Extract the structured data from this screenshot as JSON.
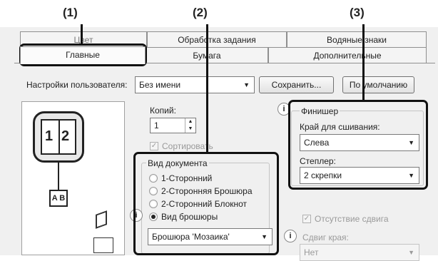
{
  "callouts": [
    "(1)",
    "(2)",
    "(3)"
  ],
  "tabs": {
    "main": "Главные",
    "paper": "Бумага",
    "job": "Обработка задания",
    "watermarks": "Водяные знаки",
    "advanced": "Дополнительные",
    "hidden": "Цвет"
  },
  "user_settings": {
    "label": "Настройки пользователя:",
    "value": "Без имени",
    "save": "Сохранить...",
    "default": "По умолчанию"
  },
  "copies": {
    "label": "Копий:",
    "value": "1"
  },
  "collate": {
    "label": "Сортировать"
  },
  "preview": {
    "page_numbers": [
      "1",
      "2"
    ],
    "book_label": "A B"
  },
  "document_type": {
    "title": "Вид документа",
    "options": [
      "1-Сторонний",
      "2-Сторонняя Брошюра",
      "2-Сторонний Блокнот",
      "Вид брошюры"
    ],
    "selected": "Вид брошюры",
    "booklet_select": "Брошюра 'Мозаика'"
  },
  "finisher": {
    "title": "Финишер",
    "binding_label": "Край для сшивания:",
    "binding_value": "Слева",
    "staple_label": "Степлер:",
    "staple_value": "2 скрепки"
  },
  "no_offset": {
    "label": "Отсутствие сдвига"
  },
  "shift": {
    "label": "Сдвиг края:",
    "value": "Нет"
  },
  "info_glyph": "i"
}
